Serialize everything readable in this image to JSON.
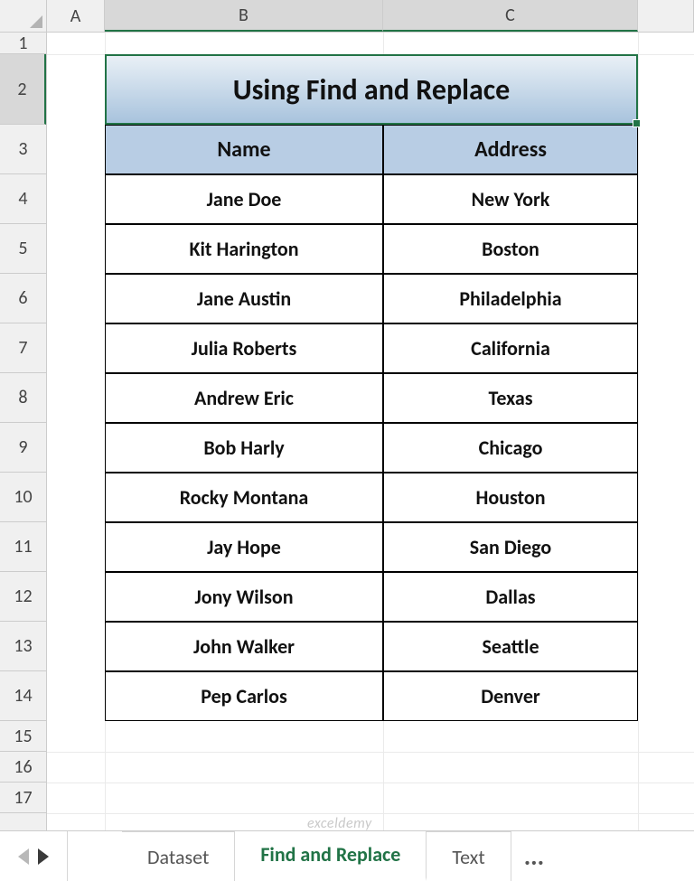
{
  "columns": {
    "A": "A",
    "B": "B",
    "C": "C"
  },
  "row_labels": [
    "1",
    "2",
    "3",
    "4",
    "5",
    "6",
    "7",
    "8",
    "9",
    "10",
    "11",
    "12",
    "13",
    "14",
    "15",
    "16",
    "17"
  ],
  "title": "Using Find and Replace",
  "headers": {
    "name": "Name",
    "address": "Address"
  },
  "rows": [
    {
      "name": "Jane Doe",
      "address": "New York"
    },
    {
      "name": "Kit Harington",
      "address": "Boston"
    },
    {
      "name": "Jane Austin",
      "address": "Philadelphia"
    },
    {
      "name": "Julia Roberts",
      "address": "California"
    },
    {
      "name": "Andrew Eric",
      "address": "Texas"
    },
    {
      "name": "Bob Harly",
      "address": "Chicago"
    },
    {
      "name": "Rocky Montana",
      "address": "Houston"
    },
    {
      "name": "Jay Hope",
      "address": "San Diego"
    },
    {
      "name": "Jony Wilson",
      "address": "Dallas"
    },
    {
      "name": "John Walker",
      "address": "Seattle"
    },
    {
      "name": "Pep Carlos",
      "address": "Denver"
    }
  ],
  "tabs": {
    "dataset": "Dataset",
    "find_replace": "Find and Replace",
    "text": "Text",
    "more": "..."
  },
  "watermark": "exceldemy"
}
